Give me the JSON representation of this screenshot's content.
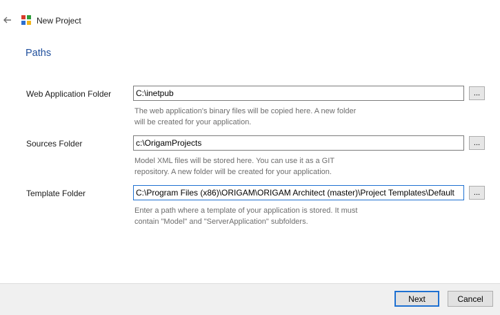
{
  "window": {
    "title": "New Project"
  },
  "section": {
    "title": "Paths"
  },
  "fields": {
    "web_app": {
      "label": "Web Application Folder",
      "value": "C:\\inetpub",
      "browse_label": "...",
      "help": "The web application's binary files will be copied here. A new folder\nwill be created for your application."
    },
    "sources": {
      "label": "Sources Folder",
      "value": "c:\\OrigamProjects",
      "browse_label": "...",
      "help": "Model XML files will be stored here. You can use it as a GIT\nrepository. A new folder will be created for your application."
    },
    "template": {
      "label": "Template Folder",
      "value": "C:\\Program Files (x86)\\ORIGAM\\ORIGAM Architect (master)\\Project Templates\\Default",
      "browse_label": "...",
      "help": "Enter a path where a template of your application is stored. It must\ncontain \"Model\" and \"ServerApplication\" subfolders."
    }
  },
  "footer": {
    "next_label": "Next",
    "cancel_label": "Cancel"
  },
  "colors": {
    "section_title": "#1e4e9c",
    "focus_border": "#1c6fd1",
    "help_text": "#6d6d6d",
    "footer_bg": "#f0f0f0"
  },
  "icons": {
    "back": "arrow-left-icon",
    "logo": "origam-logo-icon"
  }
}
